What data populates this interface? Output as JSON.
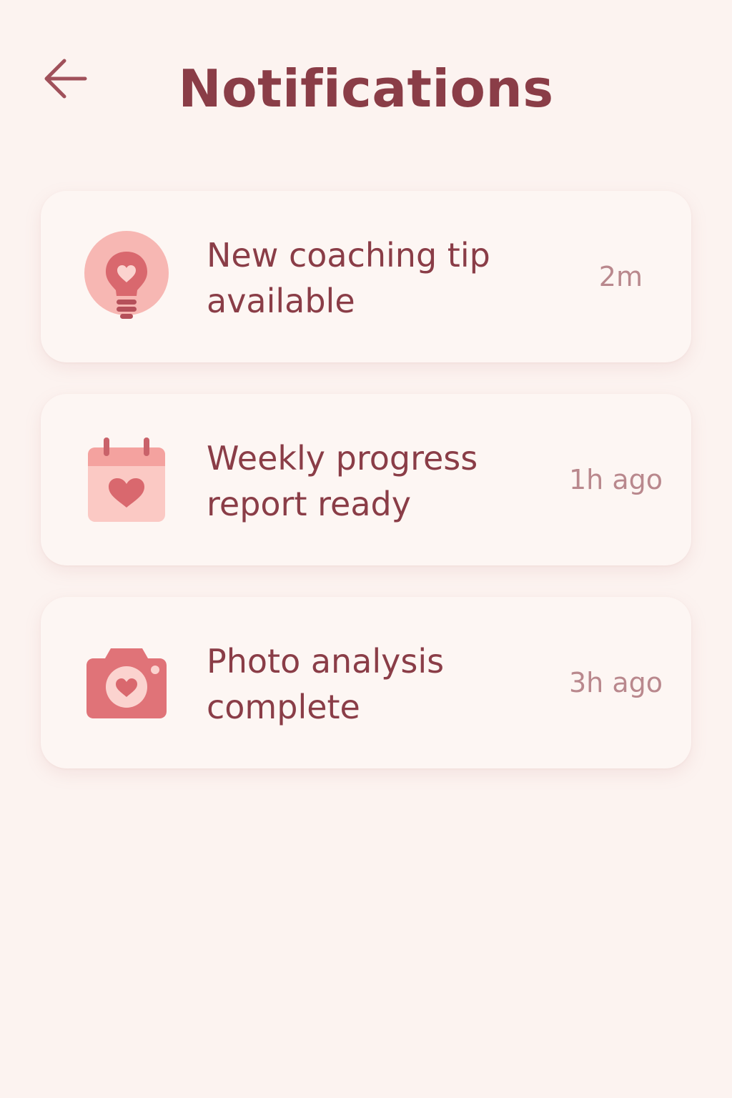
{
  "header": {
    "title": "Notifications",
    "back_icon": "arrow-left-icon"
  },
  "colors": {
    "background": "#fcf3f0",
    "card": "#fdf6f3",
    "primary_text": "#8a3d47",
    "muted_text": "#b9888d",
    "icon_accent": "#e07378",
    "icon_light": "#f7b7b3"
  },
  "notifications": [
    {
      "title": "New coaching tip available",
      "time": "2m",
      "icon": "lightbulb-heart-icon"
    },
    {
      "title": "Weekly progress report ready",
      "time": "1h ago",
      "icon": "calendar-heart-icon"
    },
    {
      "title": "Photo analysis complete",
      "time": "3h ago",
      "icon": "camera-heart-icon"
    }
  ]
}
